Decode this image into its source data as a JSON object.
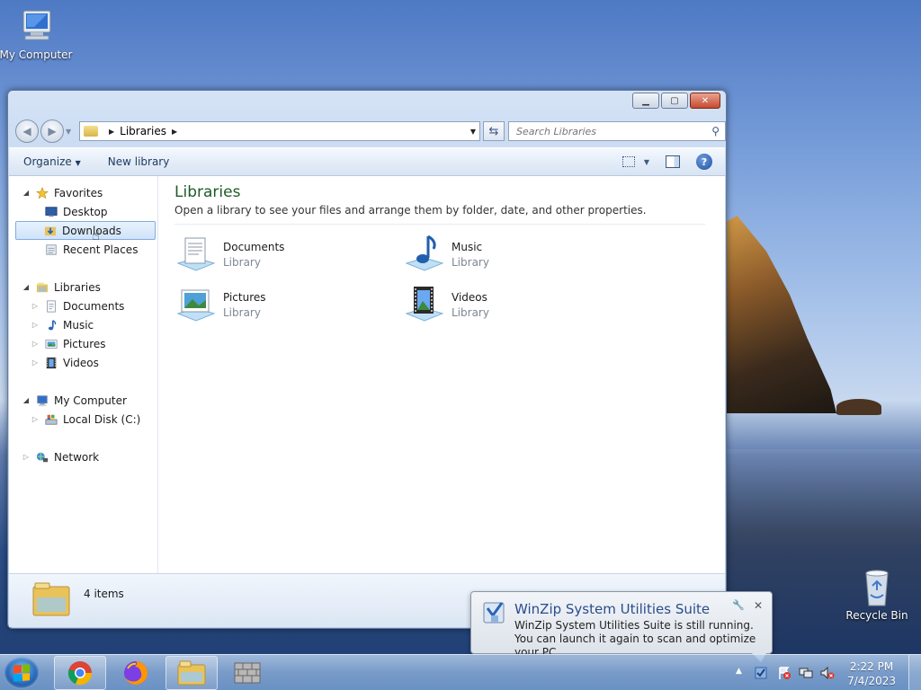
{
  "desktop": {
    "icons": [
      {
        "label": "My Computer"
      },
      {
        "label": "Recycle Bin"
      }
    ]
  },
  "window": {
    "address": {
      "segment": "Libraries"
    },
    "search": {
      "placeholder": "Search Libraries"
    },
    "toolbar": {
      "organize": "Organize",
      "new_library": "New library"
    },
    "nav": {
      "favorites": "Favorites",
      "favorites_items": [
        "Desktop",
        "Downloads",
        "Recent Places"
      ],
      "libraries": "Libraries",
      "libraries_items": [
        "Documents",
        "Music",
        "Pictures",
        "Videos"
      ],
      "computer": "My Computer",
      "computer_items": [
        "Local Disk (C:)"
      ],
      "network": "Network"
    },
    "main": {
      "title": "Libraries",
      "subtitle": "Open a library to see your files and arrange them by folder, date, and other properties.",
      "tiles": [
        {
          "name": "Documents",
          "kind": "Library"
        },
        {
          "name": "Music",
          "kind": "Library"
        },
        {
          "name": "Pictures",
          "kind": "Library"
        },
        {
          "name": "Videos",
          "kind": "Library"
        }
      ]
    },
    "status": {
      "count": "4 items"
    }
  },
  "balloon": {
    "title": "WinZip System Utilities Suite",
    "message": "WinZip System Utilities Suite is still running. You can launch it again to scan and optimize your PC."
  },
  "taskbar": {
    "time": "2:22 PM",
    "date": "7/4/2023"
  },
  "colors": {
    "accent_title": "#1e5b27",
    "link_blue": "#1e3a5f",
    "selection": "#cfe3f9"
  }
}
